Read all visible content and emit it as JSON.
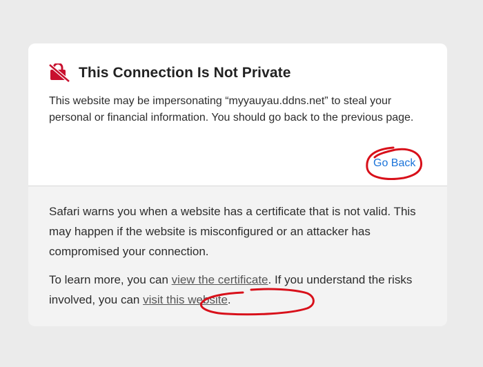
{
  "dialog": {
    "icon": "private-connection-warning-icon",
    "title": "This Connection Is Not Private",
    "intro": "This website may be impersonating “myyauyau.ddns.net” to steal your personal or financial information. You should go back to the previous page.",
    "go_back_label": "Go Back",
    "explanation": "Safari warns you when a website has a certificate that is not valid. This may happen if the website is misconfigured or an attacker has compromised your connection.",
    "learn_more_prefix": "To learn more, you can ",
    "view_certificate_label": "view the certificate",
    "learn_more_middle": ". If you understand the risks involved, you can ",
    "visit_website_label": "visit this website",
    "learn_more_suffix": "."
  },
  "colors": {
    "background": "#ebebeb",
    "card_top": "#ffffff",
    "card_bottom": "#f3f3f3",
    "accent": "#1a73d9",
    "warning_red": "#c8102e",
    "annotation_red": "#d8101a"
  }
}
